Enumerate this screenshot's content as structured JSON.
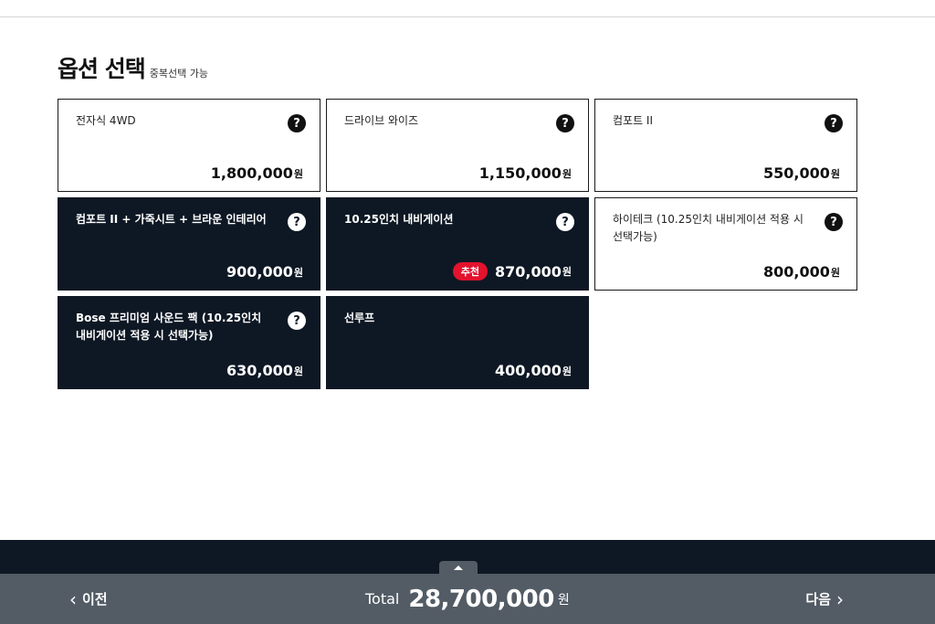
{
  "header": {
    "title": "옵션 선택",
    "subtitle": "중복선택 가능"
  },
  "options": [
    {
      "name": "전자식 4WD",
      "price": "1,800,000",
      "unit": "원",
      "help": "?",
      "selected": false,
      "badge": ""
    },
    {
      "name": "드라이브 와이즈",
      "price": "1,150,000",
      "unit": "원",
      "help": "?",
      "selected": false,
      "badge": ""
    },
    {
      "name": "컴포트 II",
      "price": "550,000",
      "unit": "원",
      "help": "?",
      "selected": false,
      "badge": ""
    },
    {
      "name": "컴포트 II + 가죽시트 + 브라운 인테리어",
      "price": "900,000",
      "unit": "원",
      "help": "?",
      "selected": true,
      "badge": ""
    },
    {
      "name": "10.25인치 내비게이션",
      "price": "870,000",
      "unit": "원",
      "help": "?",
      "selected": true,
      "badge": "추천"
    },
    {
      "name": "하이테크 (10.25인치 내비게이션 적용 시 선택가능)",
      "price": "800,000",
      "unit": "원",
      "help": "?",
      "selected": false,
      "badge": ""
    },
    {
      "name": "Bose 프리미엄 사운드 팩 (10.25인치 내비게이션 적용 시 선택가능)",
      "price": "630,000",
      "unit": "원",
      "help": "?",
      "selected": true,
      "badge": ""
    },
    {
      "name": "선루프",
      "price": "400,000",
      "unit": "원",
      "help": "",
      "selected": true,
      "badge": ""
    }
  ],
  "footer": {
    "prev_label": "이전",
    "next_label": "다음",
    "prev_icon": "‹",
    "next_icon": "›",
    "total_label": "Total",
    "total_amount": "28,700,000",
    "total_unit": "원"
  },
  "colors": {
    "selected_bg": "#0e1824",
    "badge": "#e3122d",
    "footer_bar": "#535c65"
  }
}
